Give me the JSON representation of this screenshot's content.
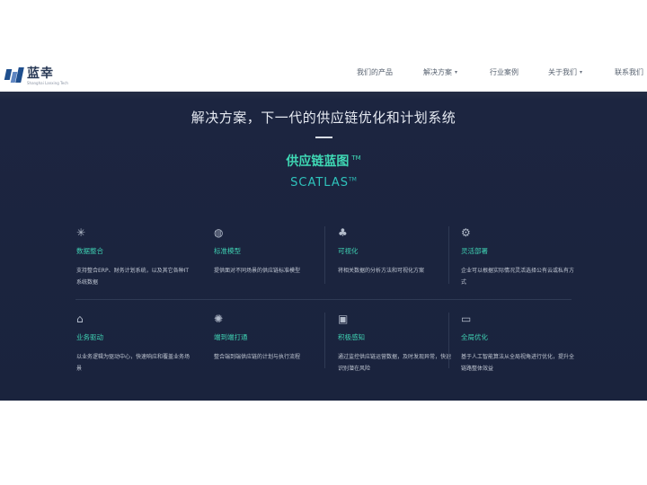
{
  "logo": {
    "name": "蓝幸",
    "sub": "Shanghai Lanxing Tech"
  },
  "nav": {
    "items": [
      {
        "label": "我们的产品",
        "caret": false
      },
      {
        "label": "解决方案",
        "caret": true
      },
      {
        "label": "行业案例",
        "caret": false
      },
      {
        "label": "关于我们",
        "caret": true
      },
      {
        "label": "联系我们",
        "caret": false
      }
    ]
  },
  "hero": {
    "title": "解决方案，下一代的供应链优化和计划系统",
    "product": "供应链蓝图",
    "product_tm": "TM",
    "brand": "SCATLAS",
    "brand_tm": "TM"
  },
  "features": [
    {
      "icon": "snowflake-icon",
      "title": "数据整合",
      "desc": "支持整合ERP、财务计划系统，以及其它各种IT系统数据"
    },
    {
      "icon": "globe-icon",
      "title": "标准模型",
      "desc": "提供面对不同场景的供应链标准模型"
    },
    {
      "icon": "network-icon",
      "title": "可视化",
      "desc": "将相关数据的分析方法和可视化方案"
    },
    {
      "icon": "flow-icon",
      "title": "灵活部署",
      "desc": "企业可以根据实际情况灵活选择公有云或私有方式"
    },
    {
      "icon": "factory-icon",
      "title": "业务驱动",
      "desc": "以业务逻辑为驱动中心，快速响应和覆盖业务场景"
    },
    {
      "icon": "sparkle-icon",
      "title": "端到端打通",
      "desc": "整合端到端供应链的计划与执行流程"
    },
    {
      "icon": "robot-icon",
      "title": "积极感知",
      "desc": "通过监控供应链运营数据，及时发现异常，快速识别潜在风险"
    },
    {
      "icon": "card-icon",
      "title": "全局优化",
      "desc": "基于人工智能算法从全局视角进行优化，提升全链路整体效益"
    }
  ]
}
